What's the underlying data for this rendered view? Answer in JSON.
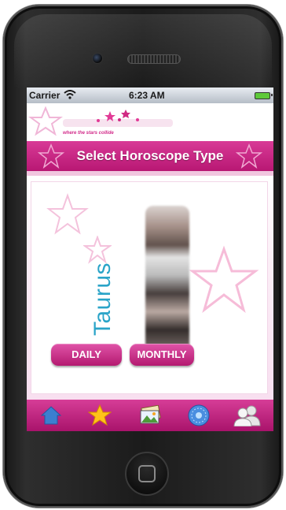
{
  "status_bar": {
    "carrier": "Carrier",
    "time": "6:23 AM"
  },
  "logo": {
    "tagline": "where the stars collide"
  },
  "header": {
    "title": "Select Horoscope Type"
  },
  "sign": {
    "name": "Taurus"
  },
  "buttons": {
    "daily": "DAILY",
    "monthly": "MONTHLY"
  },
  "tabs": [
    {
      "icon": "home-icon"
    },
    {
      "icon": "star-icon"
    },
    {
      "icon": "photos-icon"
    },
    {
      "icon": "zodiac-wheel-icon"
    },
    {
      "icon": "people-icon"
    }
  ],
  "colors": {
    "accent": "#c9237f",
    "sign_text": "#2aa4c8",
    "star": "#ffc21a"
  }
}
